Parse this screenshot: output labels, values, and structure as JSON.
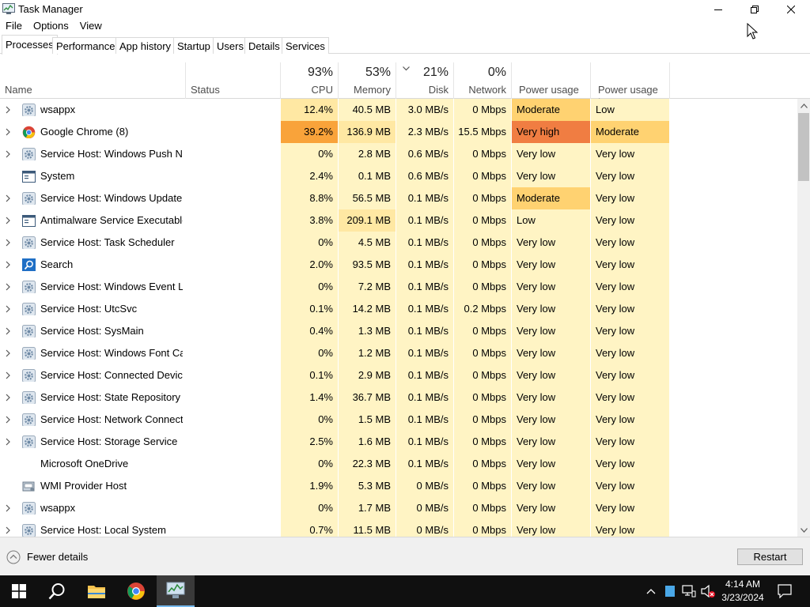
{
  "window": {
    "title": "Task Manager"
  },
  "menu": [
    "File",
    "Options",
    "View"
  ],
  "tabs": [
    "Processes",
    "Performance",
    "App history",
    "Startup",
    "Users",
    "Details",
    "Services"
  ],
  "active_tab": "Processes",
  "header": {
    "name": "Name",
    "status": "Status",
    "cpu": {
      "pct": "93%",
      "label": "CPU"
    },
    "memory": {
      "pct": "53%",
      "label": "Memory"
    },
    "disk": {
      "pct": "21%",
      "label": "Disk"
    },
    "network": {
      "pct": "0%",
      "label": "Network"
    },
    "power": "Power usage",
    "power_trend": "Power usage t..."
  },
  "colors": {
    "heat_light": "#fff4c4",
    "heat_mid": "#ffe8a3",
    "heat_strong": "#ffd77a",
    "heat_orange": "#f9a33a",
    "power_moderate": "#ffd271",
    "power_veryhigh": "#f07d42",
    "accent": "#0078d7"
  },
  "processes": [
    {
      "name": "wsappx",
      "icon": "gear-icon",
      "expand": true,
      "cpu": "12.4%",
      "memory": "40.5 MB",
      "disk": "3.0 MB/s",
      "network": "0 Mbps",
      "power": "Moderate",
      "power_trend": "Low",
      "cpu_heat": "heat_mid",
      "mem_heat": "heat_light",
      "power_color": "power_moderate",
      "trend_color": "heat_light"
    },
    {
      "name": "Google Chrome (8)",
      "icon": "chrome-icon",
      "expand": true,
      "cpu": "39.2%",
      "memory": "136.9 MB",
      "disk": "2.3 MB/s",
      "network": "15.5 Mbps",
      "power": "Very high",
      "power_trend": "Moderate",
      "cpu_heat": "heat_orange",
      "mem_heat": "heat_mid",
      "power_color": "power_veryhigh",
      "trend_color": "power_moderate"
    },
    {
      "name": "Service Host: Windows Push No...",
      "icon": "gear-icon",
      "expand": true,
      "cpu": "0%",
      "memory": "2.8 MB",
      "disk": "0.6 MB/s",
      "network": "0 Mbps",
      "power": "Very low",
      "power_trend": "Very low",
      "cpu_heat": "heat_light",
      "mem_heat": "heat_light",
      "power_color": "heat_light",
      "trend_color": "heat_light"
    },
    {
      "name": "System",
      "icon": "window-icon",
      "expand": false,
      "cpu": "2.4%",
      "memory": "0.1 MB",
      "disk": "0.6 MB/s",
      "network": "0 Mbps",
      "power": "Very low",
      "power_trend": "Very low",
      "cpu_heat": "heat_light",
      "mem_heat": "heat_light",
      "power_color": "heat_light",
      "trend_color": "heat_light"
    },
    {
      "name": "Service Host: Windows Update",
      "icon": "gear-icon",
      "expand": true,
      "cpu": "8.8%",
      "memory": "56.5 MB",
      "disk": "0.1 MB/s",
      "network": "0 Mbps",
      "power": "Moderate",
      "power_trend": "Very low",
      "cpu_heat": "heat_light",
      "mem_heat": "heat_light",
      "power_color": "power_moderate",
      "trend_color": "heat_light"
    },
    {
      "name": "Antimalware Service Executable",
      "icon": "window-icon",
      "expand": true,
      "cpu": "3.8%",
      "memory": "209.1 MB",
      "disk": "0.1 MB/s",
      "network": "0 Mbps",
      "power": "Low",
      "power_trend": "Very low",
      "cpu_heat": "heat_light",
      "mem_heat": "heat_mid",
      "power_color": "heat_light",
      "trend_color": "heat_light"
    },
    {
      "name": "Service Host: Task Scheduler",
      "icon": "gear-icon",
      "expand": true,
      "cpu": "0%",
      "memory": "4.5 MB",
      "disk": "0.1 MB/s",
      "network": "0 Mbps",
      "power": "Very low",
      "power_trend": "Very low",
      "cpu_heat": "heat_light",
      "mem_heat": "heat_light",
      "power_color": "heat_light",
      "trend_color": "heat_light"
    },
    {
      "name": "Search",
      "icon": "search-app-icon",
      "expand": true,
      "cpu": "2.0%",
      "memory": "93.5 MB",
      "disk": "0.1 MB/s",
      "network": "0 Mbps",
      "power": "Very low",
      "power_trend": "Very low",
      "cpu_heat": "heat_light",
      "mem_heat": "heat_light",
      "power_color": "heat_light",
      "trend_color": "heat_light"
    },
    {
      "name": "Service Host: Windows Event Log",
      "icon": "gear-icon",
      "expand": true,
      "cpu": "0%",
      "memory": "7.2 MB",
      "disk": "0.1 MB/s",
      "network": "0 Mbps",
      "power": "Very low",
      "power_trend": "Very low",
      "cpu_heat": "heat_light",
      "mem_heat": "heat_light",
      "power_color": "heat_light",
      "trend_color": "heat_light"
    },
    {
      "name": "Service Host: UtcSvc",
      "icon": "gear-icon",
      "expand": true,
      "cpu": "0.1%",
      "memory": "14.2 MB",
      "disk": "0.1 MB/s",
      "network": "0.2 Mbps",
      "power": "Very low",
      "power_trend": "Very low",
      "cpu_heat": "heat_light",
      "mem_heat": "heat_light",
      "power_color": "heat_light",
      "trend_color": "heat_light"
    },
    {
      "name": "Service Host: SysMain",
      "icon": "gear-icon",
      "expand": true,
      "cpu": "0.4%",
      "memory": "1.3 MB",
      "disk": "0.1 MB/s",
      "network": "0 Mbps",
      "power": "Very low",
      "power_trend": "Very low",
      "cpu_heat": "heat_light",
      "mem_heat": "heat_light",
      "power_color": "heat_light",
      "trend_color": "heat_light"
    },
    {
      "name": "Service Host: Windows Font Ca...",
      "icon": "gear-icon",
      "expand": true,
      "cpu": "0%",
      "memory": "1.2 MB",
      "disk": "0.1 MB/s",
      "network": "0 Mbps",
      "power": "Very low",
      "power_trend": "Very low",
      "cpu_heat": "heat_light",
      "mem_heat": "heat_light",
      "power_color": "heat_light",
      "trend_color": "heat_light"
    },
    {
      "name": "Service Host: Connected Device...",
      "icon": "gear-icon",
      "expand": true,
      "cpu": "0.1%",
      "memory": "2.9 MB",
      "disk": "0.1 MB/s",
      "network": "0 Mbps",
      "power": "Very low",
      "power_trend": "Very low",
      "cpu_heat": "heat_light",
      "mem_heat": "heat_light",
      "power_color": "heat_light",
      "trend_color": "heat_light"
    },
    {
      "name": "Service Host: State Repository S...",
      "icon": "gear-icon",
      "expand": true,
      "cpu": "1.4%",
      "memory": "36.7 MB",
      "disk": "0.1 MB/s",
      "network": "0 Mbps",
      "power": "Very low",
      "power_trend": "Very low",
      "cpu_heat": "heat_light",
      "mem_heat": "heat_light",
      "power_color": "heat_light",
      "trend_color": "heat_light"
    },
    {
      "name": "Service Host: Network Connecti...",
      "icon": "gear-icon",
      "expand": true,
      "cpu": "0%",
      "memory": "1.5 MB",
      "disk": "0.1 MB/s",
      "network": "0 Mbps",
      "power": "Very low",
      "power_trend": "Very low",
      "cpu_heat": "heat_light",
      "mem_heat": "heat_light",
      "power_color": "heat_light",
      "trend_color": "heat_light"
    },
    {
      "name": "Service Host: Storage Service",
      "icon": "gear-icon",
      "expand": true,
      "cpu": "2.5%",
      "memory": "1.6 MB",
      "disk": "0.1 MB/s",
      "network": "0 Mbps",
      "power": "Very low",
      "power_trend": "Very low",
      "cpu_heat": "heat_light",
      "mem_heat": "heat_light",
      "power_color": "heat_light",
      "trend_color": "heat_light"
    },
    {
      "name": "Microsoft OneDrive",
      "icon": "none",
      "expand": false,
      "cpu": "0%",
      "memory": "22.3 MB",
      "disk": "0.1 MB/s",
      "network": "0 Mbps",
      "power": "Very low",
      "power_trend": "Very low",
      "cpu_heat": "heat_light",
      "mem_heat": "heat_light",
      "power_color": "heat_light",
      "trend_color": "heat_light"
    },
    {
      "name": "WMI Provider Host",
      "icon": "wmi-icon",
      "expand": false,
      "cpu": "1.9%",
      "memory": "5.3 MB",
      "disk": "0 MB/s",
      "network": "0 Mbps",
      "power": "Very low",
      "power_trend": "Very low",
      "cpu_heat": "heat_light",
      "mem_heat": "heat_light",
      "power_color": "heat_light",
      "trend_color": "heat_light"
    },
    {
      "name": "wsappx",
      "icon": "gear-icon",
      "expand": true,
      "cpu": "0%",
      "memory": "1.7 MB",
      "disk": "0 MB/s",
      "network": "0 Mbps",
      "power": "Very low",
      "power_trend": "Very low",
      "cpu_heat": "heat_light",
      "mem_heat": "heat_light",
      "power_color": "heat_light",
      "trend_color": "heat_light"
    },
    {
      "name": "Service Host: Local System",
      "icon": "gear-icon",
      "expand": true,
      "cpu": "0.7%",
      "memory": "11.5 MB",
      "disk": "0 MB/s",
      "network": "0 Mbps",
      "power": "Very low",
      "power_trend": "Very low",
      "cpu_heat": "heat_light",
      "mem_heat": "heat_light",
      "power_color": "heat_light",
      "trend_color": "heat_light"
    }
  ],
  "footer": {
    "fewer_details": "Fewer details",
    "restart": "Restart"
  },
  "taskbar": {
    "time": "4:14 AM",
    "date": "3/23/2024"
  }
}
